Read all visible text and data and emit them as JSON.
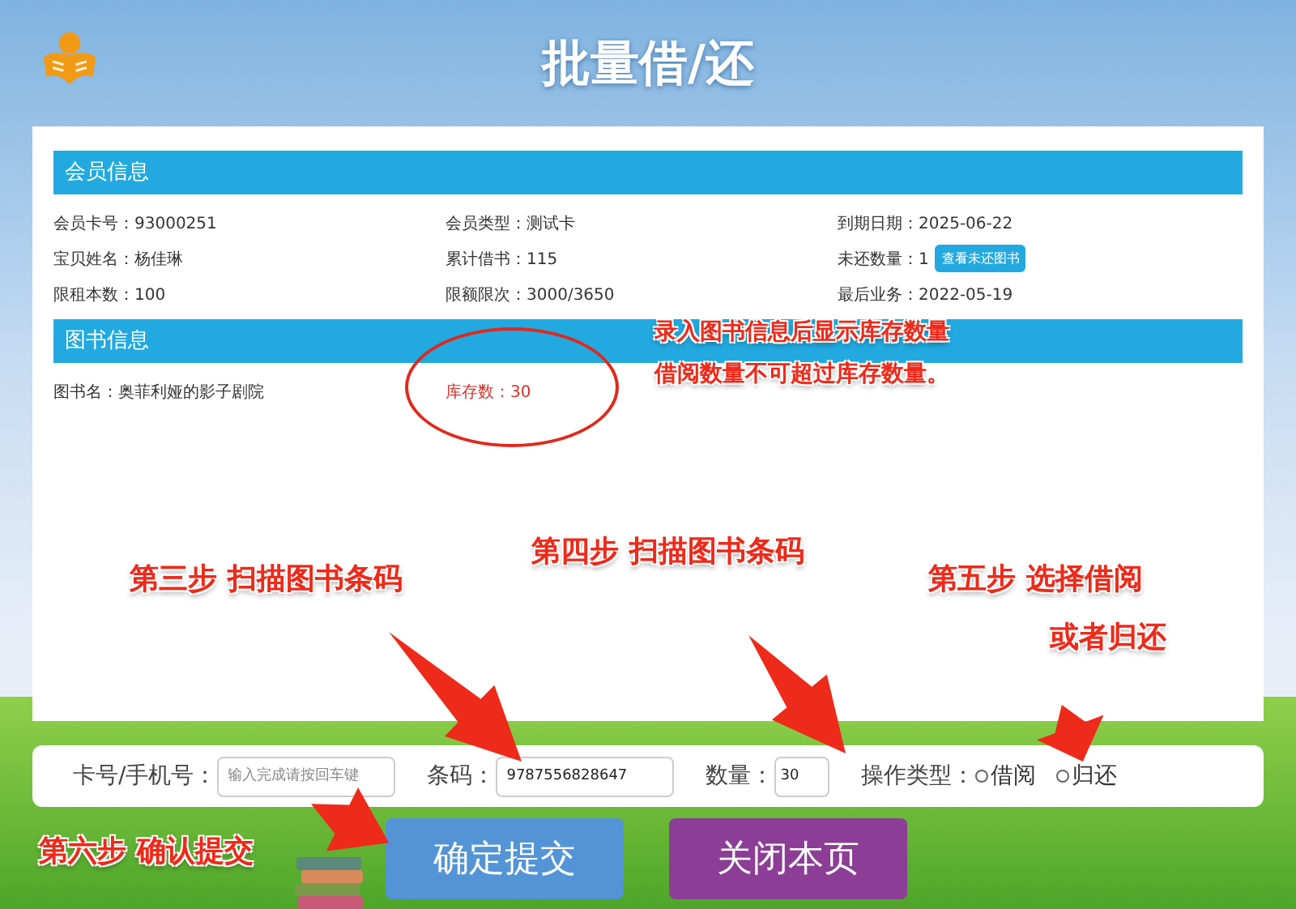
{
  "header": {
    "title": "批量借/还"
  },
  "member_section": {
    "title": "会员信息",
    "fields": [
      {
        "label": "会员卡号：",
        "value": "93000251"
      },
      {
        "label": "会员类型：",
        "value": "测试卡"
      },
      {
        "label": "到期日期：",
        "value": "2025-06-22"
      },
      {
        "label": "宝贝姓名：",
        "value": "杨佳琳"
      },
      {
        "label": "累计借书：",
        "value": "115"
      },
      {
        "label": "未还数量：",
        "value": "1",
        "button": "查看未还图书"
      },
      {
        "label": "限租本数：",
        "value": "100"
      },
      {
        "label": "限额限次：",
        "value": "3000/3650"
      },
      {
        "label": "最后业务：",
        "value": "2022-05-19"
      }
    ]
  },
  "book_section": {
    "title": "图书信息",
    "fields": [
      {
        "label": "图书名：",
        "value": "奥菲利娅的影子剧院",
        "highlighted": false
      },
      {
        "label": "库存数：",
        "value": "30",
        "highlighted": true
      }
    ]
  },
  "form": {
    "card_field": {
      "label": "卡号/手机号：",
      "placeholder": "输入完成请按回车键"
    },
    "barcode_field": {
      "label": "条码：",
      "value": "9787556828647"
    },
    "quantity_field": {
      "label": "数量：",
      "value": "30"
    },
    "operation": {
      "label": "操作类型：",
      "options": [
        {
          "label": "借阅",
          "selected": false
        },
        {
          "label": "归还",
          "selected": false
        }
      ]
    }
  },
  "buttons": [
    {
      "label": "确定提交",
      "kind": "submit"
    },
    {
      "label": "关闭本页",
      "kind": "close"
    }
  ],
  "annotations": [
    {
      "kind": "note",
      "lines": [
        "录入图书信息后显示库存数量",
        "借阅数量不可超过库存数量。"
      ]
    },
    {
      "kind": "step",
      "lines": [
        "第三步  扫描图书条码"
      ]
    },
    {
      "kind": "step",
      "lines": [
        "第四步  扫描图书条码"
      ]
    },
    {
      "kind": "step",
      "lines": [
        "第五步  选择借阅",
        "或者归还"
      ]
    },
    {
      "kind": "step",
      "lines": [
        "第六步  确认提交"
      ]
    }
  ]
}
